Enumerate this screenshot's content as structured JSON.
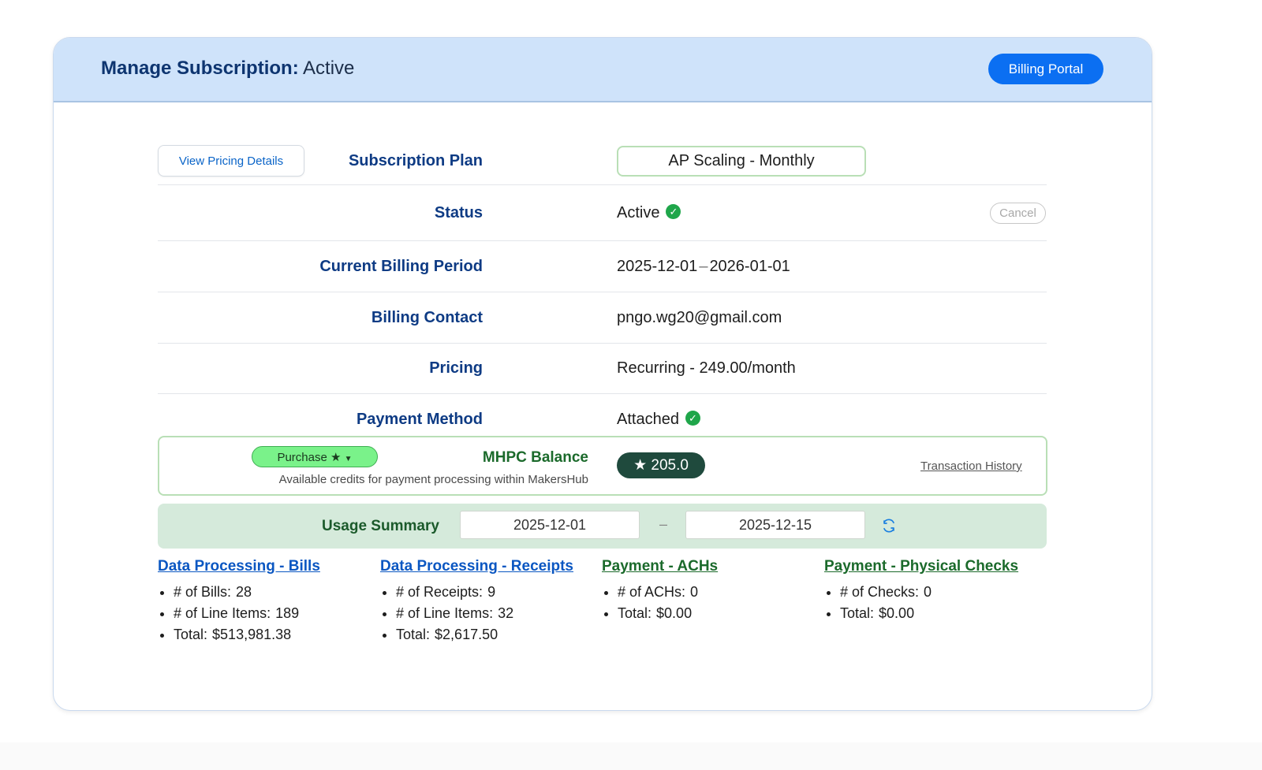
{
  "header": {
    "title_label": "Manage Subscription:",
    "title_status": "Active",
    "billing_portal_label": "Billing Portal"
  },
  "view_pricing_label": "View Pricing Details",
  "rows": {
    "plan": {
      "label": "Subscription Plan",
      "value": "AP Scaling - Monthly"
    },
    "status": {
      "label": "Status",
      "value": "Active",
      "cancel_label": "Cancel"
    },
    "billing_period": {
      "label": "Current Billing Period",
      "start": "2025-12-01",
      "end": "2026-01-01"
    },
    "billing_contact": {
      "label": "Billing Contact",
      "value": "pngo.wg20@gmail.com"
    },
    "pricing": {
      "label": "Pricing",
      "value": "Recurring - 249.00/month"
    },
    "payment_method": {
      "label": "Payment Method",
      "value": "Attached"
    }
  },
  "mhpc": {
    "purchase_label": "Purchase",
    "label": "MHPC Balance",
    "sub": "Available credits for payment processing within MakersHub",
    "balance": "205.0",
    "transaction_history_label": "Transaction History"
  },
  "usage": {
    "label": "Usage Summary",
    "start": "2025-12-01",
    "end": "2025-12-15",
    "separator": "–"
  },
  "summary": [
    {
      "title": "Data Processing - Bills",
      "items": [
        {
          "k": "# of Bills:",
          "v": "28"
        },
        {
          "k": "# of Line Items:",
          "v": "189"
        },
        {
          "k": "Total:",
          "v": "$513,981.38"
        }
      ]
    },
    {
      "title": "Data Processing - Receipts",
      "items": [
        {
          "k": "# of Receipts:",
          "v": "9"
        },
        {
          "k": "# of Line Items:",
          "v": "32"
        },
        {
          "k": "Total:",
          "v": "$2,617.50"
        }
      ]
    },
    {
      "title": "Payment - ACHs",
      "items": [
        {
          "k": "# of ACHs:",
          "v": "0"
        },
        {
          "k": "Total:",
          "v": "$0.00"
        }
      ]
    },
    {
      "title": "Payment - Physical Checks",
      "items": [
        {
          "k": "# of Checks:",
          "v": "0"
        },
        {
          "k": "Total:",
          "v": "$0.00"
        }
      ]
    }
  ],
  "colors": {
    "header_bg": "#cfe3fa",
    "primary_blue": "#0b6ff2",
    "label_blue": "#0e3b84",
    "success_green": "#1fa64a",
    "balance_bg": "#1f4a3d",
    "usage_bg": "#d5eadb"
  },
  "icons": {
    "status_check": "check-circle-icon",
    "payment_check": "check-circle-icon",
    "purchase_star": "star-icon",
    "purchase_caret": "caret-down-icon",
    "balance_star": "star-icon",
    "refresh": "refresh-icon"
  }
}
